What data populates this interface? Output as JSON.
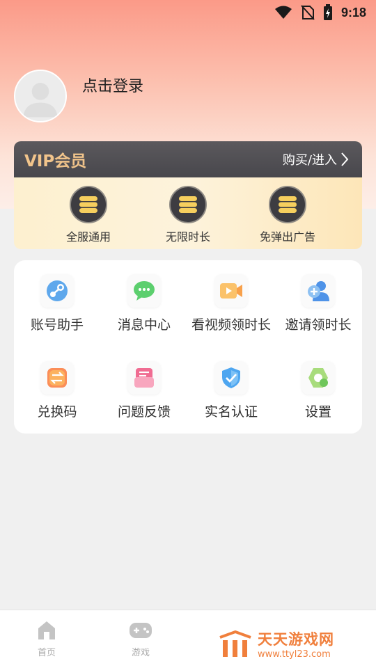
{
  "status_bar": {
    "time": "9:18"
  },
  "profile": {
    "login_text": "点击登录"
  },
  "vip": {
    "title": "VIP会员",
    "action": "购买/进入",
    "benefits": [
      {
        "label": "全服通用",
        "icon": "coin-stack-icon"
      },
      {
        "label": "无限时长",
        "icon": "coin-stack-icon"
      },
      {
        "label": "免弹出广告",
        "icon": "coin-stack-icon"
      }
    ]
  },
  "menu": {
    "items": [
      {
        "label": "账号助手",
        "icon": "steam-icon"
      },
      {
        "label": "消息中心",
        "icon": "chat-icon"
      },
      {
        "label": "看视频领时长",
        "icon": "video-icon"
      },
      {
        "label": "邀请领时长",
        "icon": "invite-user-icon"
      },
      {
        "label": "兑换码",
        "icon": "exchange-icon"
      },
      {
        "label": "问题反馈",
        "icon": "feedback-icon"
      },
      {
        "label": "实名认证",
        "icon": "shield-check-icon"
      },
      {
        "label": "设置",
        "icon": "settings-icon"
      }
    ]
  },
  "bottom_nav": {
    "tabs": [
      {
        "label": "首页",
        "icon": "home-icon"
      },
      {
        "label": "游戏",
        "icon": "gamepad-icon"
      }
    ]
  },
  "watermark": {
    "name": "天天游戏网",
    "url": "www.ttyl23.com"
  },
  "colors": {
    "vip_gold": "#f1c48b",
    "watermark_orange": "#f07f3c"
  }
}
